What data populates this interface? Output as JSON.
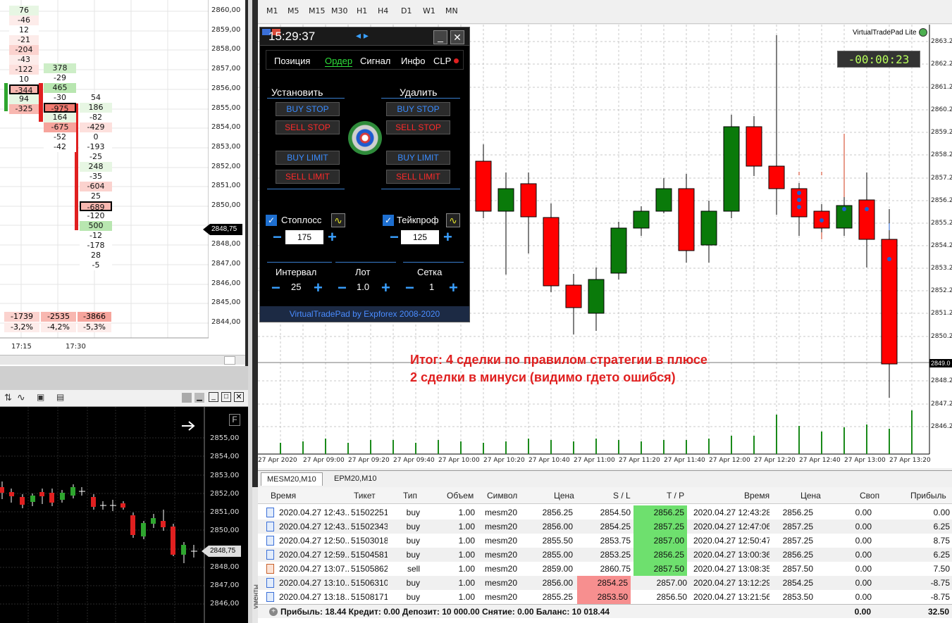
{
  "cluster": {
    "price_labels": [
      "2860,00",
      "2859,00",
      "2858,00",
      "2857,00",
      "2856,00",
      "2855,00",
      "2854,00",
      "2853,00",
      "2852,00",
      "2851,00",
      "2850,00",
      "2849,00",
      "2848,00",
      "2847,00",
      "2846,00",
      "2845,00",
      "2844,00"
    ],
    "current_price": "2848,75",
    "col1": [
      "76",
      "-46",
      "12",
      "-21",
      "-204",
      "-43",
      "-122",
      "10",
      "-344",
      "94",
      "-325"
    ],
    "col2": [
      "378",
      "-29",
      "465",
      "-30",
      "-975",
      "164",
      "-675",
      "-52",
      "-42"
    ],
    "col3": [
      "54",
      "186",
      "-82",
      "-429",
      "0",
      "-193",
      "-25",
      "248",
      "-35",
      "-604",
      "25",
      "-689",
      "-120",
      "500",
      "-12",
      "-178",
      "28",
      "-5"
    ],
    "footer_totals": [
      "-1739",
      "-2535",
      "-3866"
    ],
    "footer_pct": [
      "-3,2%",
      "-4,2%",
      "-5,3%"
    ],
    "time_labels": [
      "17:15",
      "17:30"
    ]
  },
  "mini": {
    "price_labels": [
      "2855,00",
      "2854,00",
      "2853,00",
      "2852,00",
      "2851,00",
      "2850,00",
      "2849,00",
      "2848,00",
      "2847,00",
      "2846,00"
    ],
    "current_price": "2848,75",
    "f_label": "F"
  },
  "timeframes": [
    "M1",
    "M5",
    "M15",
    "M30",
    "H1",
    "H4",
    "D1",
    "W1",
    "MN"
  ],
  "main": {
    "brand": "VirtualTradePad",
    "brand_lite": "Lite",
    "timer": "-00:00:23",
    "price_labels": [
      "2863.2",
      "2862.2",
      "2861.2",
      "2860.2",
      "2859.2",
      "2858.2",
      "2857.2",
      "2856.2",
      "2855.2",
      "2854.2",
      "2853.2",
      "2852.2",
      "2851.2",
      "2850.2",
      "2849.0",
      "2848.2",
      "2847.2",
      "2846.2"
    ],
    "current_price_tag": "2849.0",
    "time_labels": [
      "27 Apr 2020",
      "27 Apr 09:00",
      "27 Apr 09:20",
      "27 Apr 09:40",
      "27 Apr 10:00",
      "27 Apr 10:20",
      "27 Apr 10:40",
      "27 Apr 11:00",
      "27 Apr 11:20",
      "27 Apr 11:40",
      "27 Apr 12:00",
      "27 Apr 12:20",
      "27 Apr 12:40",
      "27 Apr 13:00",
      "27 Apr 13:20"
    ],
    "result_line1": "Итог: 4 сделки по правилом стратегии в плюсе",
    "result_line2": "2 сделки в минуси (видимо гдето ошибся)"
  },
  "tradepad": {
    "time": "15:29:37",
    "tabs": [
      "Позиция",
      "Ордер",
      "Сигнал",
      "Инфо",
      "CLP"
    ],
    "set_label": "Установить",
    "del_label": "Удалить",
    "buy_stop": "BUY STOP",
    "sell_stop": "SELL STOP",
    "buy_limit": "BUY LIMIT",
    "sell_limit": "SELL LIMIT",
    "stoploss_label": "Стоплосс",
    "takeprofit_label": "Тейкпроф",
    "stoploss_value": "175",
    "takeprofit_value": "125",
    "interval_label": "Интервал",
    "lot_label": "Лот",
    "grid_label": "Сетка",
    "interval_value": "25",
    "lot_value": "1.0",
    "grid_value": "1",
    "footer": "VirtualTradePad by Expforex 2008-2020"
  },
  "terminal": {
    "tabs": [
      "MESM20,M10",
      "EPM20,M10"
    ],
    "side_label": "ументы",
    "headers": [
      "Время",
      "Тикет",
      "Тип",
      "Объем",
      "Символ",
      "Цена",
      "S / L",
      "T / P",
      "Время",
      "Цена",
      "Своп",
      "Прибыль"
    ],
    "rows": [
      [
        "2020.04.27 12:43...",
        "51502251",
        "buy",
        "1.00",
        "mesm20",
        "2856.25",
        "2854.50",
        "2856.25",
        "2020.04.27 12:43:28",
        "2856.25",
        "0.00",
        "0.00"
      ],
      [
        "2020.04.27 12:43...",
        "51502343",
        "buy",
        "1.00",
        "mesm20",
        "2856.00",
        "2854.25",
        "2857.25",
        "2020.04.27 12:47:06",
        "2857.25",
        "0.00",
        "6.25"
      ],
      [
        "2020.04.27 12:50...",
        "51503018",
        "buy",
        "1.00",
        "mesm20",
        "2855.50",
        "2853.75",
        "2857.00",
        "2020.04.27 12:50:47",
        "2857.25",
        "0.00",
        "8.75"
      ],
      [
        "2020.04.27 12:59...",
        "51504581",
        "buy",
        "1.00",
        "mesm20",
        "2855.00",
        "2853.25",
        "2856.25",
        "2020.04.27 13:00:36",
        "2856.25",
        "0.00",
        "6.25"
      ],
      [
        "2020.04.27 13:07...",
        "51505862",
        "sell",
        "1.00",
        "mesm20",
        "2859.00",
        "2860.75",
        "2857.50",
        "2020.04.27 13:08:35",
        "2857.50",
        "0.00",
        "7.50"
      ],
      [
        "2020.04.27 13:10...",
        "51506310",
        "buy",
        "1.00",
        "mesm20",
        "2856.00",
        "2854.25",
        "2857.00",
        "2020.04.27 13:12:29",
        "2854.25",
        "0.00",
        "-8.75"
      ],
      [
        "2020.04.27 13:18...",
        "51508171",
        "buy",
        "1.00",
        "mesm20",
        "2855.25",
        "2853.50",
        "2856.50",
        "2020.04.27 13:21:56",
        "2853.50",
        "0.00",
        "-8.75"
      ]
    ],
    "summary": "Прибыль: 18.44  Кредит: 0.00  Депозит: 10 000.00  Снятие: 0.00  Баланс: 10 018.44",
    "summary_swap": "0.00",
    "summary_profit": "32.50"
  }
}
